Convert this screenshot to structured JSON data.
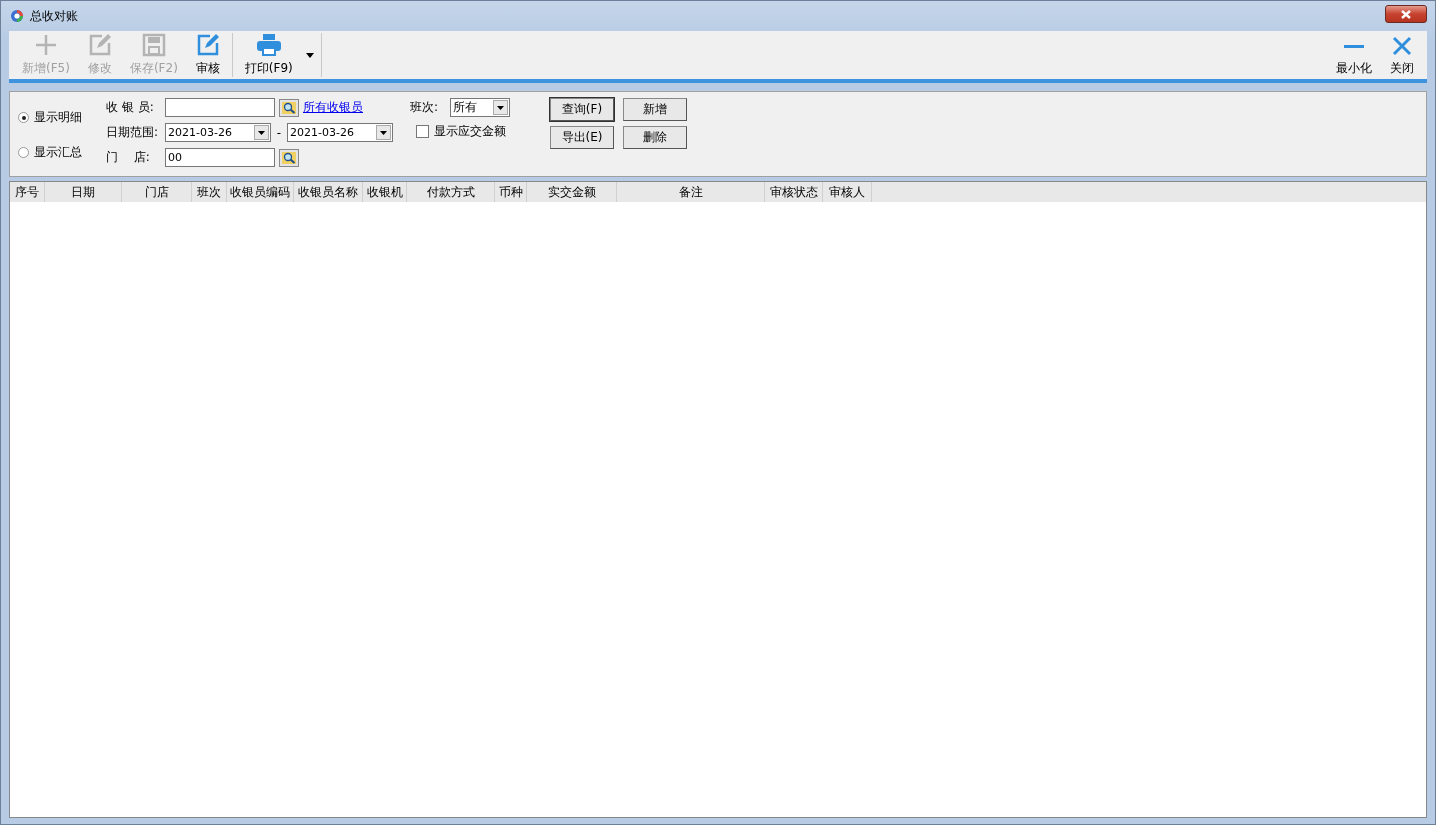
{
  "window": {
    "title": "总收对账"
  },
  "toolbar": {
    "left": [
      {
        "label": "新增(F5)",
        "kind": "add",
        "disabled": true
      },
      {
        "label": "修改",
        "kind": "edit",
        "disabled": true
      },
      {
        "label": "保存(F2)",
        "kind": "save",
        "disabled": true
      },
      {
        "label": "审核",
        "kind": "audit",
        "disabled": false
      },
      {
        "label": "打印(F9)",
        "kind": "print",
        "disabled": false
      }
    ],
    "right": [
      {
        "label": "最小化",
        "kind": "minimize"
      },
      {
        "label": "关闭",
        "kind": "close"
      }
    ]
  },
  "filters": {
    "view_modes": [
      {
        "label": "显示明细",
        "selected": true
      },
      {
        "label": "显示汇总",
        "selected": false
      }
    ],
    "cashier": {
      "label": "收 银 员:",
      "link": "所有收银员"
    },
    "date_range": {
      "label": "日期范围:",
      "from": "2021-03-26",
      "separator": "-",
      "to": "2021-03-26"
    },
    "store": {
      "label": "门　 店:",
      "value": "00"
    },
    "shift": {
      "label": "班次:",
      "value": "所有"
    },
    "show_due": {
      "label": "显示应交金额",
      "checked": false
    },
    "buttons": [
      "查询(F)",
      "新增",
      "导出(E)",
      "删除"
    ]
  },
  "table": {
    "columns": [
      "序号",
      "日期",
      "门店",
      "班次",
      "收银员编码",
      "收银员名称",
      "收银机",
      "付款方式",
      "币种",
      "实交金额",
      "备注",
      "审核状态",
      "审核人"
    ]
  }
}
